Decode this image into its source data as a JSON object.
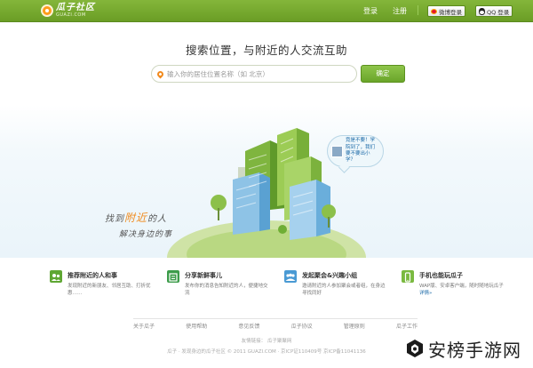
{
  "header": {
    "logo_cn": "瓜子社区",
    "logo_en": "GUAZI.COM",
    "login_label": "登录",
    "register_label": "注册",
    "weibo_login_label": "微博登录",
    "qq_login_label": "QQ 登录"
  },
  "search": {
    "title": "搜索位置，与附近的人交流互助",
    "placeholder": "输入你的居住位置名称（如 北京）",
    "confirm_label": "确定"
  },
  "hero": {
    "tagline_pre": "找到",
    "tagline_highlight": "附近",
    "tagline_post": "的人",
    "tagline_line2": "解决身边的事",
    "bubble_text": "竟是不要！学院到了，我们要不要出小学？"
  },
  "features": [
    {
      "title": "推荐附近的人和事",
      "desc": "发现附近的新朋友、邻居互助、打折优惠……",
      "more": "",
      "color": "#5fa733"
    },
    {
      "title": "分享新鲜事儿",
      "desc": "发布你的消息告知附近的人，便捷地交流",
      "more": "",
      "color": "#3c9c4a"
    },
    {
      "title": "发起聚会&兴趣小组",
      "desc": "邀请附近的人参加聚会或者组，在身边寻找同好",
      "more": "",
      "color": "#4a9ad4"
    },
    {
      "title": "手机也能玩瓜子",
      "desc": "WAP版、安卓客户端，随时随地玩瓜子",
      "more": "详情»",
      "color": "#7ab940"
    }
  ],
  "footer": {
    "links": [
      "关于瓜子",
      "使用帮助",
      "意见反馈",
      "瓜子协议",
      "管理原则",
      "瓜子工作"
    ],
    "friendship": "友情链接：  瓜子聚聚网",
    "copyright": "瓜子 · 发现身边的瓜子社区 © 2011 GUAZI.COM · 京ICP证110409号 京ICP备11041136"
  },
  "watermark": {
    "text": "安榜手游网"
  }
}
